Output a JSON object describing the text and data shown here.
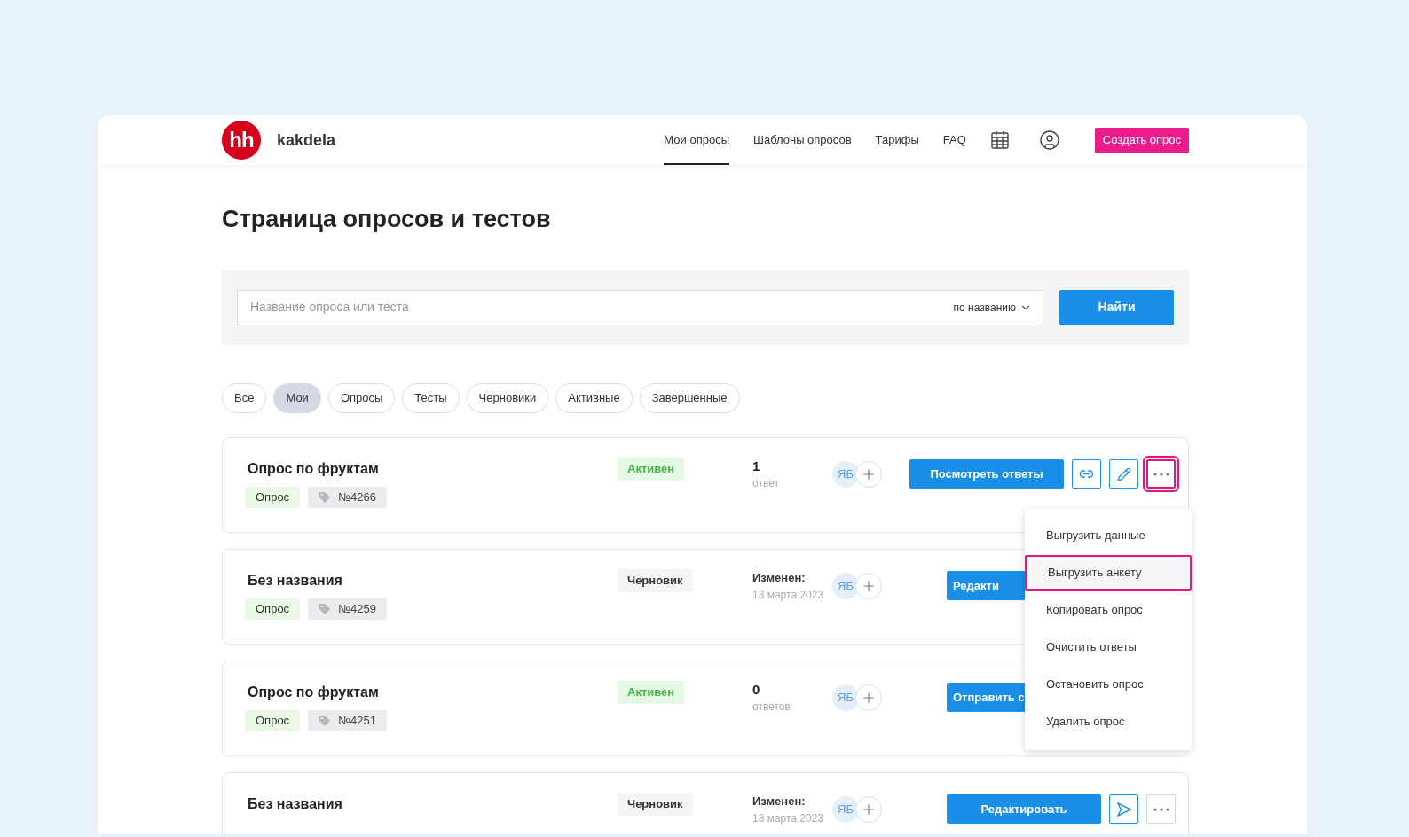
{
  "header": {
    "logo": "hh",
    "brand": "kakdela",
    "nav": [
      {
        "label": "Мои опросы",
        "selected": true
      },
      {
        "label": "Шаблоны опросов",
        "selected": false
      },
      {
        "label": "Тарифы",
        "selected": false
      },
      {
        "label": "FAQ",
        "selected": false
      }
    ],
    "create_button": "Создать опрос"
  },
  "page_title": "Страница опросов и тестов",
  "search": {
    "placeholder": "Название опроса или теста",
    "sort": "по названию",
    "button": "Найти"
  },
  "filters": [
    {
      "label": "Все",
      "selected": false
    },
    {
      "label": "Мои",
      "selected": true
    },
    {
      "label": "Опросы",
      "selected": false
    },
    {
      "label": "Тесты",
      "selected": false
    },
    {
      "label": "Черновики",
      "selected": false
    },
    {
      "label": "Активные",
      "selected": false
    },
    {
      "label": "Завершенные",
      "selected": false
    }
  ],
  "surveys": [
    {
      "title": "Опрос по фруктам",
      "type": "Опрос",
      "number": "№4266",
      "status": {
        "label": "Активен",
        "kind": "active"
      },
      "stat": {
        "kind": "count",
        "value": "1",
        "caption": "ответ"
      },
      "avatar": "ЯБ",
      "primary": {
        "label": "Посмотреть ответы",
        "covered": false
      },
      "icons": [
        {
          "kind": "link",
          "highlighted": false
        },
        {
          "kind": "edit",
          "highlighted": false
        },
        {
          "kind": "more",
          "highlighted": true
        }
      ]
    },
    {
      "title": "Без названия",
      "type": "Опрос",
      "number": "№4259",
      "status": {
        "label": "Черновик",
        "kind": "draft"
      },
      "stat": {
        "kind": "modified",
        "value": "Изменен:",
        "caption": "13 марта 2023"
      },
      "avatar": "ЯБ",
      "primary": {
        "label": "Редакти",
        "covered": true
      }
    },
    {
      "title": "Опрос по фруктам",
      "type": "Опрос",
      "number": "№4251",
      "status": {
        "label": "Активен",
        "kind": "active"
      },
      "stat": {
        "kind": "count",
        "value": "0",
        "caption": "ответов"
      },
      "avatar": "ЯБ",
      "primary": {
        "label": "Отправить с",
        "covered": true
      }
    },
    {
      "title": "Без названия",
      "status": {
        "label": "Черновик",
        "kind": "draft"
      },
      "stat": {
        "kind": "modified",
        "value": "Изменен:",
        "caption": "13 марта 2023"
      },
      "avatar": "ЯБ",
      "primary": {
        "label": "Редактировать",
        "covered": false
      },
      "icons": [
        {
          "kind": "send",
          "highlighted": false
        },
        {
          "kind": "more",
          "highlighted": false
        }
      ]
    }
  ],
  "menu": {
    "items": [
      {
        "label": "Выгрузить данные",
        "highlighted": false
      },
      {
        "label": "Выгрузить анкету",
        "highlighted": true
      },
      {
        "label": "Копировать опрос",
        "highlighted": false
      },
      {
        "label": "Очистить ответы",
        "highlighted": false
      },
      {
        "label": "Остановить опрос",
        "highlighted": false
      },
      {
        "label": "Удалить опрос",
        "highlighted": false
      }
    ]
  }
}
